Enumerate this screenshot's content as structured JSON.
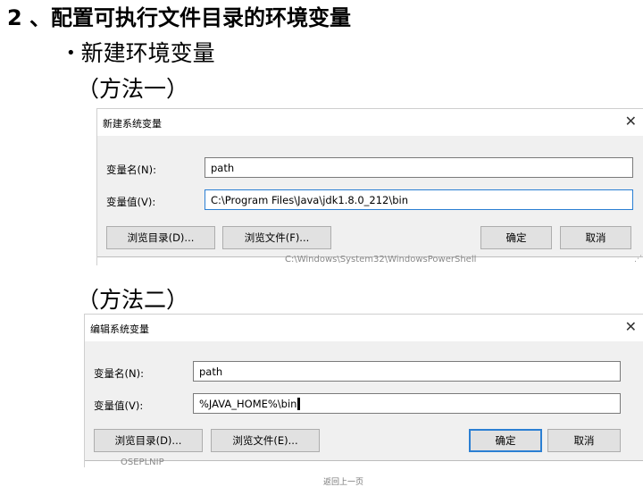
{
  "slide": {
    "title": "2 、配置可执行文件目录的环境变量",
    "bullet_marker": "•",
    "bullet": "新建环境变量",
    "method_1": "（方法一）",
    "method_2": "（方法二）"
  },
  "dialog_1": {
    "title": "新建系统变量",
    "close": "✕",
    "name_label": "变量名(N):",
    "name_value": "path",
    "value_label": "变量值(V):",
    "value_value": "C:\\Program Files\\Java\\jdk1.8.0_212\\bin",
    "browse_dir": "浏览目录(D)...",
    "browse_file": "浏览文件(F)...",
    "ok": "确定",
    "cancel": "取消",
    "background_text": "C:\\Windows\\System32\\WindowsPowerShell"
  },
  "dialog_2": {
    "title": "编辑系统变量",
    "close": "✕",
    "name_label": "变量名(N):",
    "name_value": "path",
    "value_label": "变量值(V):",
    "value_value": "%JAVA_HOME%\\bin",
    "browse_dir": "浏览目录(D)...",
    "browse_file": "浏览文件(E)...",
    "ok": "确定",
    "cancel": "取消",
    "background_text": "OSEPLNIP"
  },
  "footer": "返回上一页",
  "colors": {
    "dialog_bg": "#f0f0f0",
    "focus_border": "#2b7fd3",
    "button_bg": "#e1e1e1"
  }
}
